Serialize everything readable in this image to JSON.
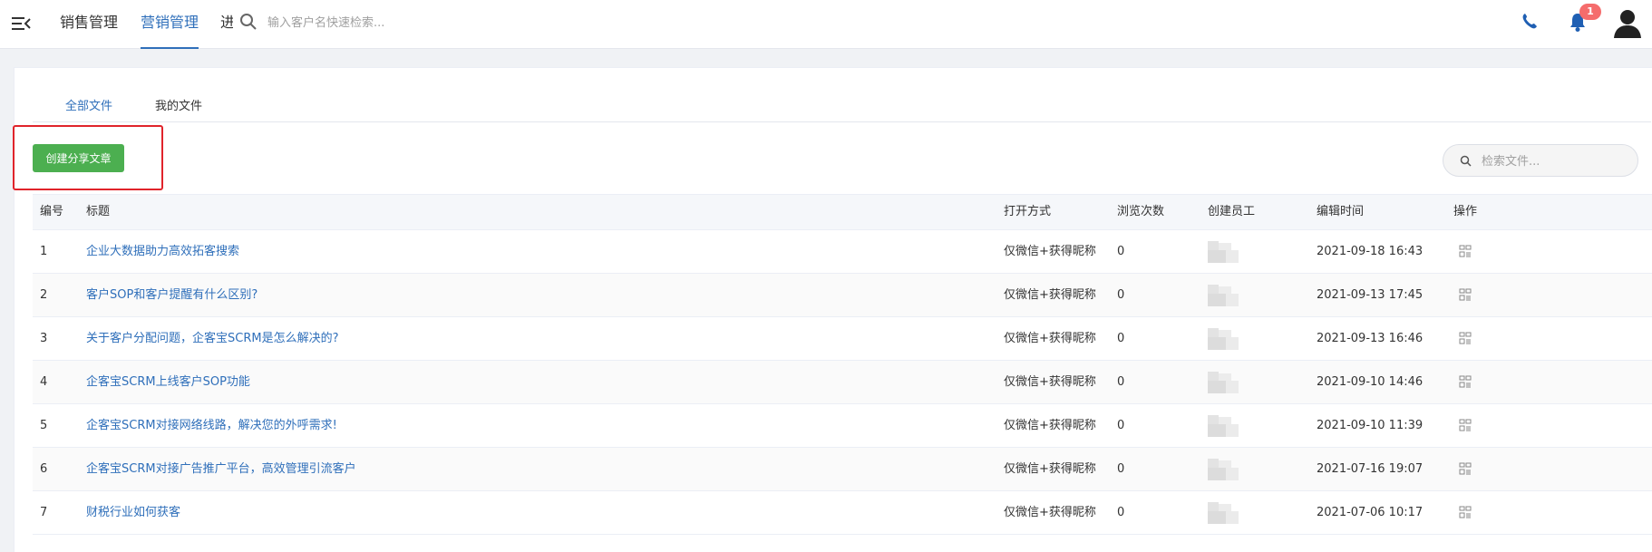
{
  "header": {
    "nav_tabs": [
      {
        "label": "销售管理",
        "active": false
      },
      {
        "label": "营销管理",
        "active": true
      }
    ],
    "nav_truncated": "进",
    "search_placeholder": "输入客户名快速检索...",
    "notification_count": "1"
  },
  "file_tabs": [
    {
      "label": "全部文件",
      "active": true
    },
    {
      "label": "我的文件",
      "active": false
    }
  ],
  "create_button_label": "创建分享文章",
  "file_search_placeholder": "检索文件...",
  "table": {
    "columns": [
      "编号",
      "标题",
      "打开方式",
      "浏览次数",
      "创建员工",
      "编辑时间",
      "操作"
    ],
    "rows": [
      {
        "no": "1",
        "title": "企业大数据助力高效拓客搜索",
        "open": "仅微信+获得昵称",
        "views": "0",
        "time": "2021-09-18 16:43"
      },
      {
        "no": "2",
        "title": "客户SOP和客户提醒有什么区别?",
        "open": "仅微信+获得昵称",
        "views": "0",
        "time": "2021-09-13 17:45"
      },
      {
        "no": "3",
        "title": "关于客户分配问题，企客宝SCRM是怎么解决的?",
        "open": "仅微信+获得昵称",
        "views": "0",
        "time": "2021-09-13 16:46"
      },
      {
        "no": "4",
        "title": "企客宝SCRM上线客户SOP功能",
        "open": "仅微信+获得昵称",
        "views": "0",
        "time": "2021-09-10 14:46"
      },
      {
        "no": "5",
        "title": "企客宝SCRM对接网络线路，解决您的外呼需求!",
        "open": "仅微信+获得昵称",
        "views": "0",
        "time": "2021-09-10 11:39"
      },
      {
        "no": "6",
        "title": "企客宝SCRM对接广告推广平台，高效管理引流客户",
        "open": "仅微信+获得昵称",
        "views": "0",
        "time": "2021-07-16 19:07"
      },
      {
        "no": "7",
        "title": "财税行业如何获客",
        "open": "仅微信+获得昵称",
        "views": "0",
        "time": "2021-07-06 10:17"
      }
    ]
  },
  "colors": {
    "accent": "#2f6fba",
    "create_button": "#4caf50",
    "highlight_box": "#e0242b",
    "badge": "#f56c6c"
  }
}
